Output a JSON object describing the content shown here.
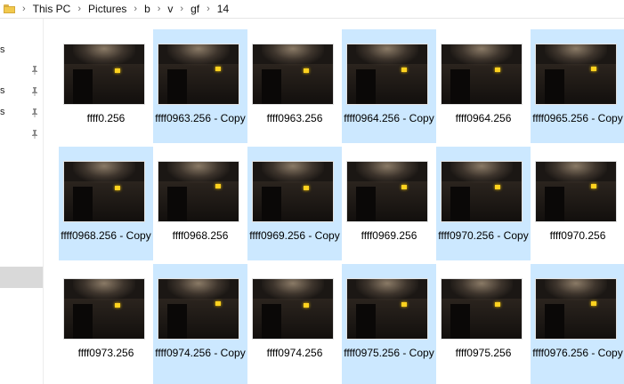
{
  "breadcrumb": {
    "items": [
      "This PC",
      "Pictures",
      "b",
      "v",
      "gf",
      "14"
    ]
  },
  "nav": {
    "items": [
      "s",
      "s",
      "s"
    ]
  },
  "files": [
    {
      "name": "ffff0.256",
      "selected": false
    },
    {
      "name": "ffff0963.256 - Copy",
      "selected": true
    },
    {
      "name": "ffff0963.256",
      "selected": false
    },
    {
      "name": "ffff0964.256 - Copy",
      "selected": true
    },
    {
      "name": "ffff0964.256",
      "selected": false
    },
    {
      "name": "ffff0965.256 - Copy",
      "selected": true
    },
    {
      "name": "ffff0968.256 - Copy",
      "selected": true
    },
    {
      "name": "ffff0968.256",
      "selected": false
    },
    {
      "name": "ffff0969.256 - Copy",
      "selected": true
    },
    {
      "name": "ffff0969.256",
      "selected": false
    },
    {
      "name": "ffff0970.256 - Copy",
      "selected": true
    },
    {
      "name": "ffff0970.256",
      "selected": false
    },
    {
      "name": "ffff0973.256",
      "selected": false
    },
    {
      "name": "ffff0974.256 - Copy",
      "selected": true
    },
    {
      "name": "ffff0974.256",
      "selected": false
    },
    {
      "name": "ffff0975.256 - Copy",
      "selected": true
    },
    {
      "name": "ffff0975.256",
      "selected": false
    },
    {
      "name": "ffff0976.256 - Copy",
      "selected": true
    }
  ],
  "colors": {
    "selection": "#cce8ff",
    "folder": "#f2c94c"
  }
}
